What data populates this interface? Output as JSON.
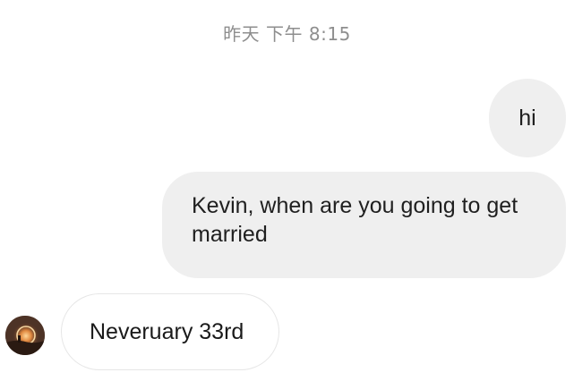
{
  "conversation": {
    "timestamp": "昨天 下午 8:15",
    "messages": [
      {
        "direction": "sent",
        "text": "hi"
      },
      {
        "direction": "sent",
        "text": "Kevin, when are you going to get married"
      },
      {
        "direction": "received",
        "text": "Neveruary 33rd"
      }
    ]
  },
  "icons": {
    "avatar": "contact-avatar-photo"
  },
  "colors": {
    "sent_bubble": "#efefef",
    "received_bubble_border": "#e6e6e6",
    "timestamp_text": "#8e8e8e"
  }
}
